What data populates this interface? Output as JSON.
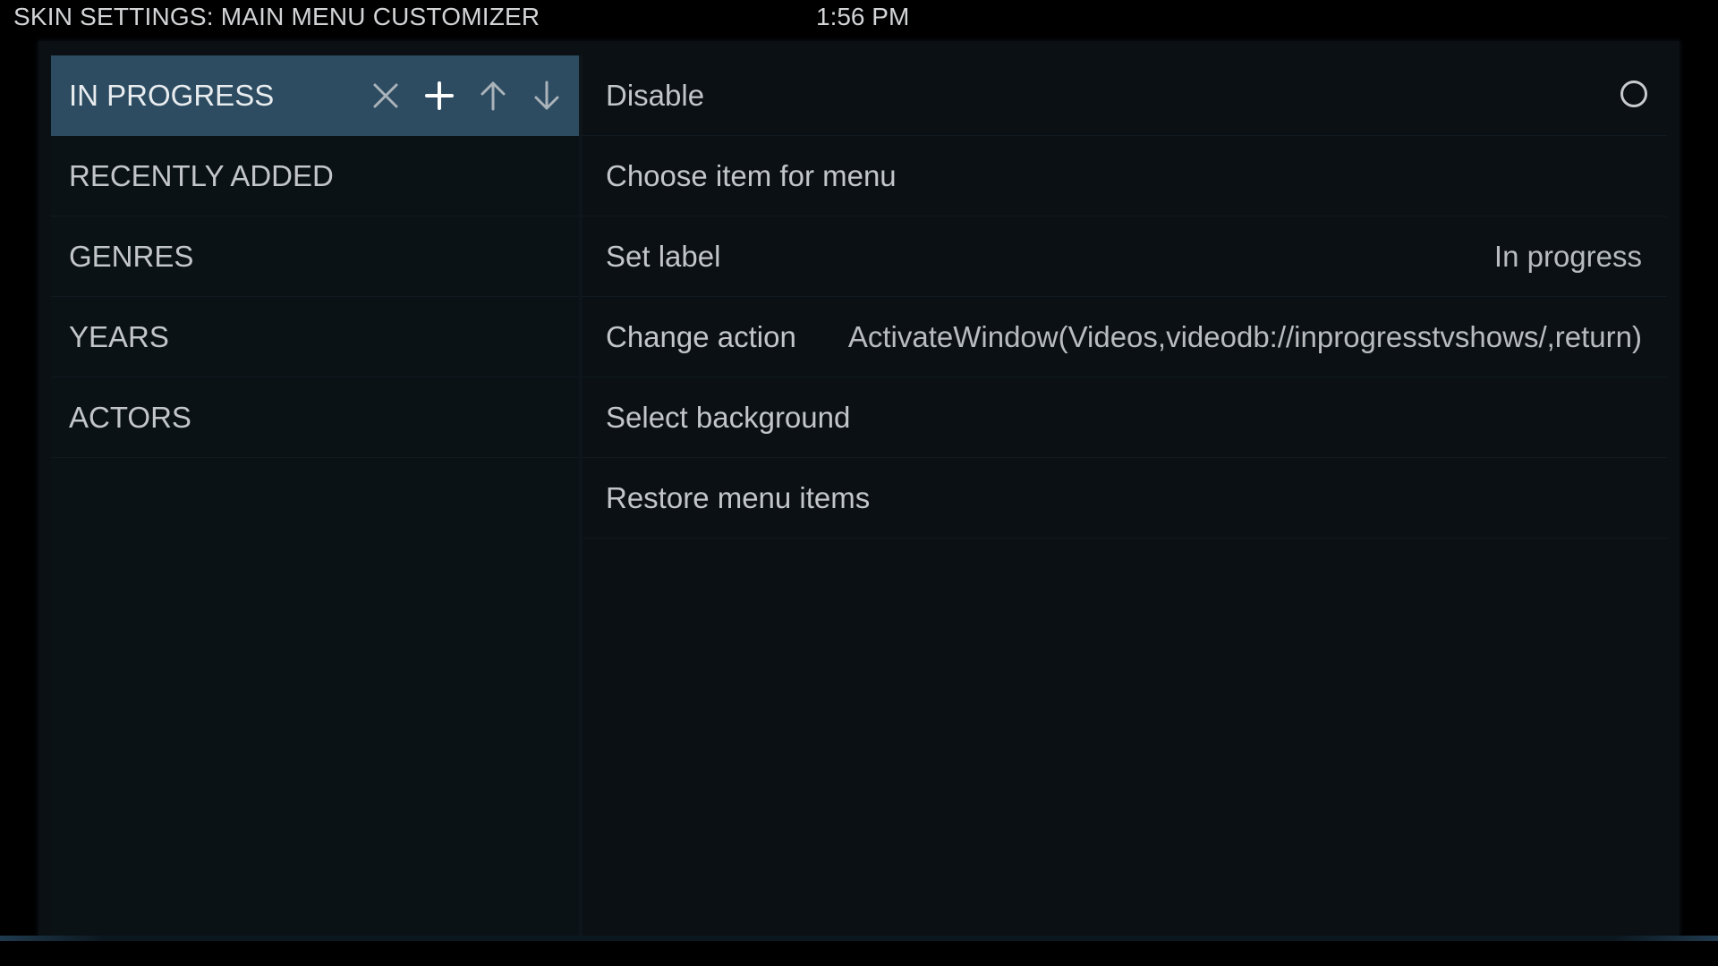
{
  "header": {
    "title": "SKIN SETTINGS: MAIN MENU CUSTOMIZER",
    "clock": "1:56 PM"
  },
  "menu_items": [
    {
      "label": "IN PROGRESS",
      "selected": true
    },
    {
      "label": "RECENTLY ADDED",
      "selected": false
    },
    {
      "label": "GENRES",
      "selected": false
    },
    {
      "label": "YEARS",
      "selected": false
    },
    {
      "label": "ACTORS",
      "selected": false
    }
  ],
  "item_actions": [
    {
      "icon": "close-icon"
    },
    {
      "icon": "plus-icon"
    },
    {
      "icon": "arrow-up-icon"
    },
    {
      "icon": "arrow-down-icon"
    }
  ],
  "options": {
    "disable": {
      "label": "Disable",
      "checked": false
    },
    "choose_item": {
      "label": "Choose item for menu"
    },
    "set_label": {
      "label": "Set label",
      "value": "In progress"
    },
    "change_action": {
      "label": "Change action",
      "value": "ActivateWindow(Videos,videodb://inprogresstvshows/,return)"
    },
    "select_background": {
      "label": "Select background"
    },
    "restore_items": {
      "label": "Restore menu items"
    }
  },
  "colors": {
    "background": "#000000",
    "panel": "#0a1014",
    "selected_item": "#2d4c61",
    "text": "#c2c6c9"
  }
}
